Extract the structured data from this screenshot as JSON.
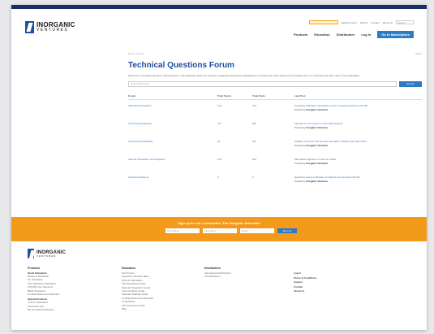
{
  "header": {
    "logo_top": "INORGANIC",
    "logo_bottom": "VENTURES",
    "util_links": [
      "Search Forum",
      "Search",
      "Contact",
      "About Us"
    ],
    "search_placeholder": "Search",
    "nav": [
      "Products",
      "Education",
      "Distributors",
      "Log In"
    ],
    "cta": "Go to Marketplace"
  },
  "breadcrumb": "Home / Forum",
  "share": "Share",
  "title": "Technical Questions Forum",
  "intro": "Welcome to Inorganic Ventures' technical forum. Ask questions about our products, analytical methods and applications or browse the topics below to find answers from our chemists and other users of our standards.",
  "search": {
    "placeholder": "Search this forum",
    "button": "Search"
  },
  "table": {
    "headers": [
      "Forum",
      "Total Topics",
      "Total Posts",
      "Last Post"
    ],
    "rows": [
      {
        "forum": "Standard Preparation",
        "topics": "102",
        "posts": "419",
        "last_title": "Preparing calibration standards for trace metals analysis by ICP-MS",
        "last_by": "Posted by",
        "last_author": "Inorganic Ventures"
      },
      {
        "forum": "Instrumental Methods",
        "topics": "167",
        "posts": "540",
        "last_title": "Interference corrections in ICP-OES analysis",
        "last_by": "Posted by",
        "last_author": "Inorganic Ventures"
      },
      {
        "forum": "Chemical Compatibility",
        "topics": "84",
        "posts": "281",
        "last_title": "Stability of mixed multi-element standards in dilute nitric acid matrix",
        "last_by": "Posted by",
        "last_author": "Inorganic Ventures"
      },
      {
        "forum": "Sample Preparation and Digestion",
        "topics": "145",
        "posts": "503",
        "last_title": "Microwave digestion of soils for metals",
        "last_by": "Posted by",
        "last_author": "Inorganic Ventures"
      },
      {
        "forum": "General Questions",
        "topics": "9",
        "posts": "6",
        "last_title": "Questions about certificates of analysis and product shelf life",
        "last_by": "Posted by",
        "last_author": "Inorganic Ventures"
      }
    ]
  },
  "newsletter": {
    "title": "Sign up for our e-newsletter, The Inorganic Advocate!",
    "first_name": "First Name",
    "last_name": "Last Name",
    "email": "Email",
    "button": "Sign Up"
  },
  "footer": {
    "logo_top": "INORGANIC",
    "logo_bottom": "VENTURES",
    "products": {
      "heading": "Products",
      "sub1": "Stock Standards",
      "items1": [
        "Metals & Metalloids",
        "Ion Standards",
        "ICP Calibration Standards",
        "ICP-MS Tune Solutions",
        "Blank Standards",
        "Certified Reference Materials"
      ],
      "sub2": "Special Products",
      "items2": [
        "Custom Standards",
        "Instrument Kits",
        "Mix and Match Solutions"
      ]
    },
    "education": {
      "heading": "Education",
      "items": [
        "Tech Forum",
        "Interactive Periodic Table",
        "Tools & Calculators",
        "ICP Operations Guide",
        "Sample Preparation Guide",
        "Trace Analysis Guide",
        "Standard Stability Guide",
        "Certified Reference Materials",
        "IV Webinars",
        "ICP Instrument Guide",
        "Blog"
      ]
    },
    "distributors": {
      "heading": "Distributors",
      "items": [
        "International Distributors",
        "US Distributors"
      ]
    },
    "company": {
      "heading": "Log In",
      "items": [
        "Terms & Conditions",
        "Careers",
        "Contact",
        "About Us"
      ]
    }
  }
}
